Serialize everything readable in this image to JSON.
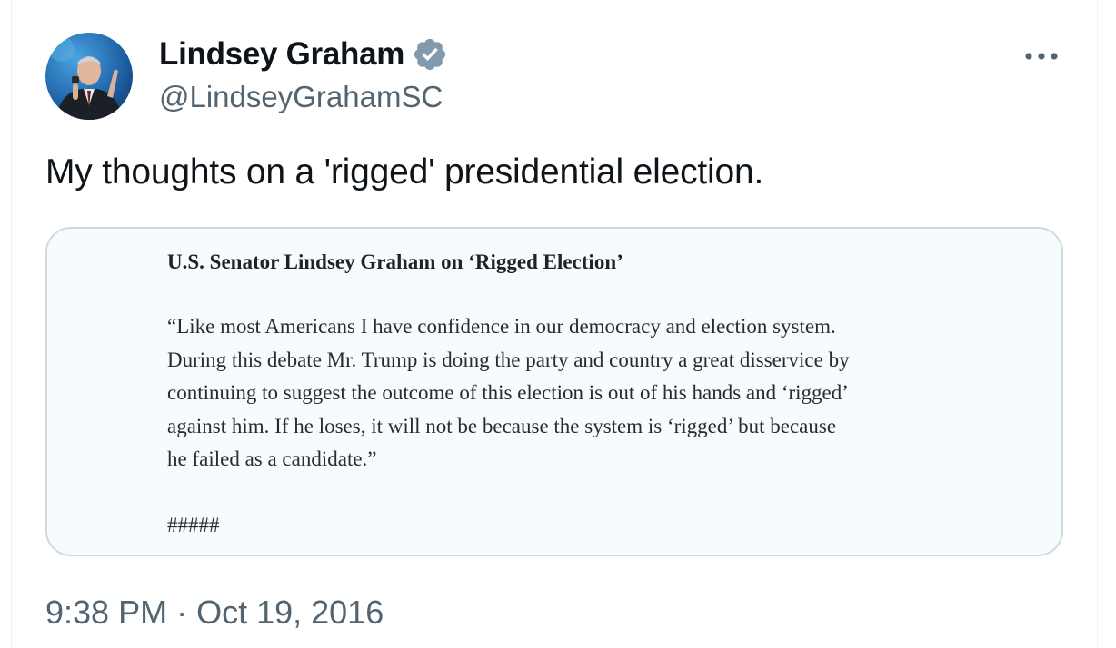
{
  "tweet": {
    "author": {
      "display_name": "Lindsey Graham",
      "handle": "@LindseyGrahamSC",
      "verified": true,
      "verified_color": "#829aab"
    },
    "text": "My thoughts on a 'rigged' presidential election.",
    "media": {
      "title": "U.S. Senator Lindsey Graham on ‘Rigged Election’",
      "body_lines": [
        "“Like most Americans I have confidence in our democracy and election system.",
        "During this debate Mr. Trump is doing the party and country a great disservice by",
        "continuing to suggest the outcome of this election is out of his hands and ‘rigged’",
        "against him.  If he loses, it will not be because the system is ‘rigged’ but because",
        "he failed as a candidate.”"
      ],
      "end_mark": "#####"
    },
    "time": "9:38 PM",
    "separator": "·",
    "date": "Oct 19, 2016"
  },
  "icons": {
    "verified": "verified-badge-icon",
    "more": "more-horizontal-icon"
  },
  "colors": {
    "text_primary": "#0f1419",
    "text_secondary": "#536471",
    "card_border": "#cfd9de",
    "card_background": "#f6fbfd"
  }
}
